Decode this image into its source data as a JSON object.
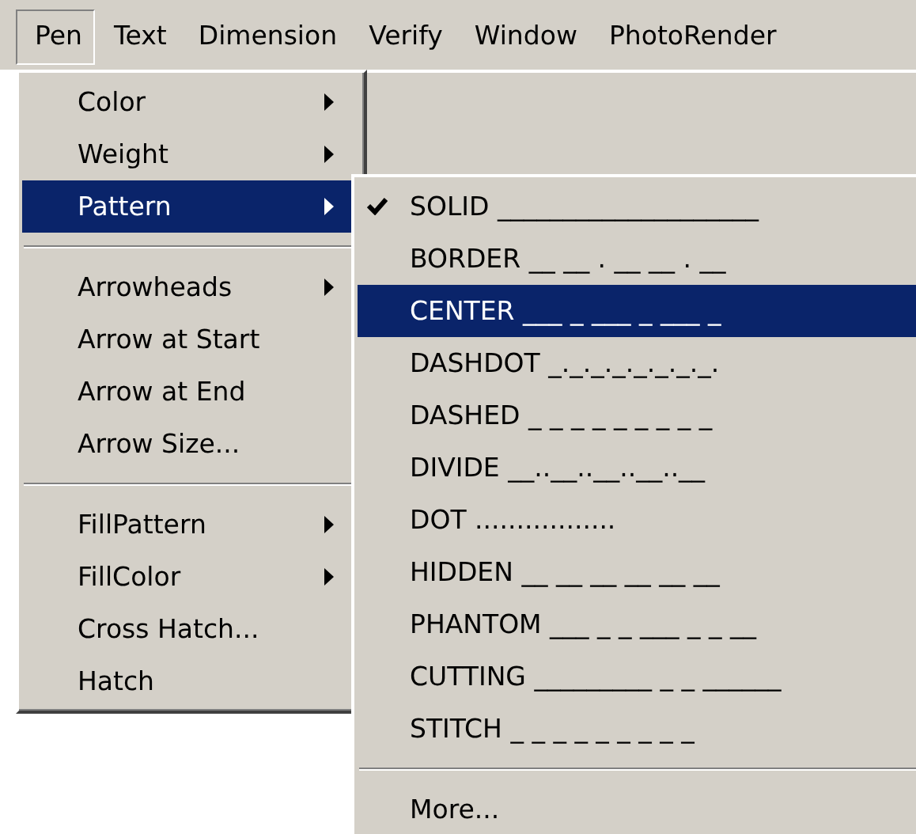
{
  "menubar": [
    {
      "label": "Pen",
      "selected": true
    },
    {
      "label": "Text",
      "selected": false
    },
    {
      "label": "Dimension",
      "selected": false
    },
    {
      "label": "Verify",
      "selected": false
    },
    {
      "label": "Window",
      "selected": false
    },
    {
      "label": "PhotoRender",
      "selected": false
    }
  ],
  "menu": [
    {
      "kind": "item",
      "label": "Color",
      "has_submenu": true,
      "selected": false
    },
    {
      "kind": "item",
      "label": "Weight",
      "has_submenu": true,
      "selected": false
    },
    {
      "kind": "item",
      "label": "Pattern",
      "has_submenu": true,
      "selected": true
    },
    {
      "kind": "separator"
    },
    {
      "kind": "item",
      "label": "Arrowheads",
      "has_submenu": true,
      "selected": false
    },
    {
      "kind": "item",
      "label": "Arrow at Start",
      "has_submenu": false,
      "selected": false
    },
    {
      "kind": "item",
      "label": "Arrow at End",
      "has_submenu": false,
      "selected": false
    },
    {
      "kind": "item",
      "label": "Arrow Size...",
      "has_submenu": false,
      "selected": false
    },
    {
      "kind": "separator"
    },
    {
      "kind": "item",
      "label": "FillPattern",
      "has_submenu": true,
      "selected": false
    },
    {
      "kind": "item",
      "label": "FillColor",
      "has_submenu": true,
      "selected": false
    },
    {
      "kind": "item",
      "label": "Cross Hatch...",
      "has_submenu": false,
      "selected": false
    },
    {
      "kind": "item",
      "label": "Hatch",
      "has_submenu": false,
      "selected": false
    }
  ],
  "submenu": [
    {
      "kind": "item",
      "label": "SOLID ____________________",
      "checked": true,
      "selected": false
    },
    {
      "kind": "item",
      "label": "BORDER __ __ . __ __ . __",
      "checked": false,
      "selected": false
    },
    {
      "kind": "item",
      "label": "CENTER ___ _ ___ _ ___ _",
      "checked": false,
      "selected": true
    },
    {
      "kind": "item",
      "label": "DASHDOT _._._._._._._._.",
      "checked": false,
      "selected": false
    },
    {
      "kind": "item",
      "label": "DASHED _ _ _ _ _ _ _ _ _",
      "checked": false,
      "selected": false
    },
    {
      "kind": "item",
      "label": "DIVIDE __..__..__..__..__",
      "checked": false,
      "selected": false
    },
    {
      "kind": "item",
      "label": "DOT .................",
      "checked": false,
      "selected": false
    },
    {
      "kind": "item",
      "label": "HIDDEN __ __ __ __ __ __",
      "checked": false,
      "selected": false
    },
    {
      "kind": "item",
      "label": "PHANTOM ___ _ _ ___ _ _ __",
      "checked": false,
      "selected": false
    },
    {
      "kind": "item",
      "label": "CUTTING _________ _ _ ______",
      "checked": false,
      "selected": false
    },
    {
      "kind": "item",
      "label": "STITCH _ _ _ _ _ _ _ _ _",
      "checked": false,
      "selected": false
    },
    {
      "kind": "separator"
    },
    {
      "kind": "item",
      "label": "More...",
      "checked": false,
      "selected": false
    }
  ]
}
